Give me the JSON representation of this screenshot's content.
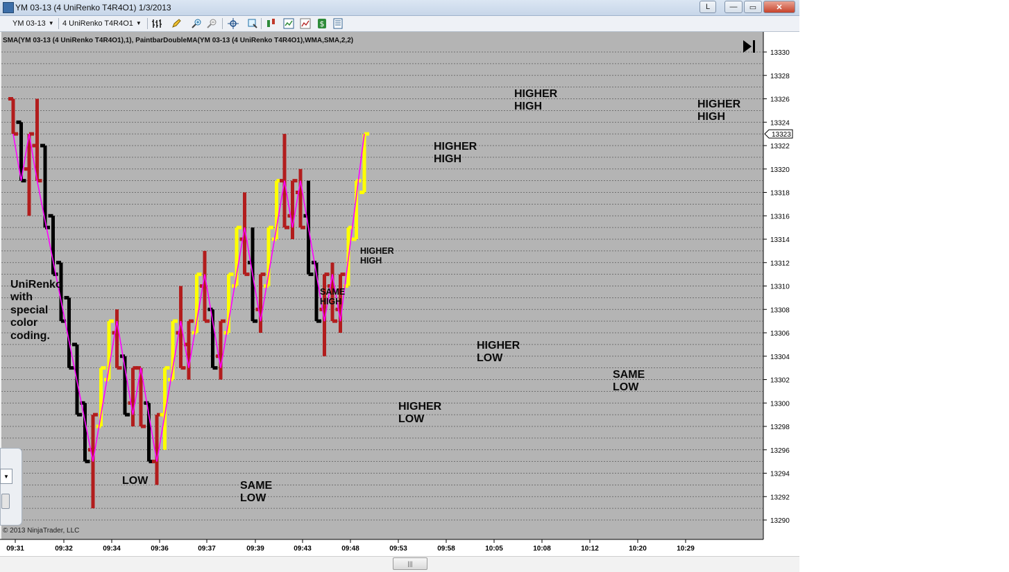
{
  "window": {
    "title": "YM 03-13 (4 UniRenko T4R4O1)  1/3/2013",
    "controls": {
      "l_label": "L",
      "minimize": "—",
      "maximize": "▭",
      "close": "✕"
    }
  },
  "toolbar": {
    "instrument": "YM 03-13",
    "period": "4 UniRenko T4R4O1",
    "icons": [
      "bar-type-icon",
      "pencil-icon",
      "zoom-in-icon",
      "zoom-out-icon",
      "crosshair-icon",
      "magnifier-icon",
      "strategy-icon",
      "indicator-icon",
      "chart-trader-icon",
      "money-icon",
      "properties-icon"
    ]
  },
  "chart": {
    "indicator_label": "SMA(YM 03-13 (4 UniRenko T4R4O1),1), PaintbarDoubleMA(YM 03-13 (4 UniRenko T4R4O1),WMA,SMA,2,2)",
    "copyright": "© 2013 NinjaTrader, LLC",
    "current_price": "13323",
    "colors": {
      "background": "#b4b4b4",
      "red": "#b21d1d",
      "black": "#000000",
      "yellow": "#ffff00",
      "line": "#ff00ff"
    }
  },
  "chart_data": {
    "type": "bar",
    "y_ticks": [
      13290,
      13292,
      13294,
      13296,
      13298,
      13300,
      13302,
      13304,
      13306,
      13308,
      13310,
      13312,
      13314,
      13316,
      13318,
      13320,
      13322,
      13324,
      13326,
      13328,
      13330
    ],
    "ylim": [
      13289,
      13331
    ],
    "x_ticks": [
      "09:31",
      "09:32",
      "09:34",
      "09:36",
      "09:37",
      "09:39",
      "09:43",
      "09:48",
      "09:53",
      "09:58",
      "10:05",
      "10:08",
      "10:12",
      "10:20",
      "10:29"
    ],
    "bars": [
      {
        "c": "r",
        "h": 13326,
        "l": 13323,
        "o": 13326,
        "cl": 13323
      },
      {
        "c": "k",
        "h": 13324,
        "l": 13319,
        "o": 13324,
        "cl": 13319
      },
      {
        "c": "r",
        "h": 13323,
        "l": 13316,
        "o": 13320,
        "cl": 13323
      },
      {
        "c": "r",
        "h": 13326,
        "l": 13319,
        "o": 13322,
        "cl": 13319
      },
      {
        "c": "k",
        "h": 13322,
        "l": 13315,
        "o": 13322,
        "cl": 13315
      },
      {
        "c": "k",
        "h": 13316,
        "l": 13311,
        "o": 13316,
        "cl": 13311
      },
      {
        "c": "k",
        "h": 13312,
        "l": 13307,
        "o": 13312,
        "cl": 13307
      },
      {
        "c": "k",
        "h": 13309,
        "l": 13303,
        "o": 13309,
        "cl": 13303
      },
      {
        "c": "k",
        "h": 13305,
        "l": 13299,
        "o": 13305,
        "cl": 13299
      },
      {
        "c": "k",
        "h": 13300,
        "l": 13295,
        "o": 13300,
        "cl": 13295
      },
      {
        "c": "r",
        "h": 13299,
        "l": 13291,
        "o": 13296,
        "cl": 13299
      },
      {
        "c": "y",
        "h": 13303,
        "l": 13298,
        "o": 13298,
        "cl": 13303
      },
      {
        "c": "y",
        "h": 13307,
        "l": 13302,
        "o": 13302,
        "cl": 13307
      },
      {
        "c": "r",
        "h": 13308,
        "l": 13303,
        "o": 13306,
        "cl": 13303
      },
      {
        "c": "k",
        "h": 13304,
        "l": 13299,
        "o": 13304,
        "cl": 13299
      },
      {
        "c": "r",
        "h": 13303,
        "l": 13298,
        "o": 13300,
        "cl": 13303
      },
      {
        "c": "r",
        "h": 13303,
        "l": 13298,
        "o": 13303,
        "cl": 13298
      },
      {
        "c": "k",
        "h": 13300,
        "l": 13295,
        "o": 13300,
        "cl": 13295
      },
      {
        "c": "r",
        "h": 13299,
        "l": 13293,
        "o": 13295,
        "cl": 13299
      },
      {
        "c": "y",
        "h": 13303,
        "l": 13296,
        "o": 13299,
        "cl": 13303
      },
      {
        "c": "y",
        "h": 13307,
        "l": 13302,
        "o": 13302,
        "cl": 13307
      },
      {
        "c": "r",
        "h": 13310,
        "l": 13303,
        "o": 13306,
        "cl": 13303
      },
      {
        "c": "r",
        "h": 13307,
        "l": 13302,
        "o": 13305,
        "cl": 13307
      },
      {
        "c": "y",
        "h": 13311,
        "l": 13306,
        "o": 13306,
        "cl": 13311
      },
      {
        "c": "r",
        "h": 13313,
        "l": 13307,
        "o": 13310,
        "cl": 13307
      },
      {
        "c": "k",
        "h": 13308,
        "l": 13303,
        "o": 13308,
        "cl": 13303
      },
      {
        "c": "r",
        "h": 13307,
        "l": 13302,
        "o": 13304,
        "cl": 13307
      },
      {
        "c": "y",
        "h": 13311,
        "l": 13306,
        "o": 13306,
        "cl": 13311
      },
      {
        "c": "y",
        "h": 13315,
        "l": 13310,
        "o": 13310,
        "cl": 13315
      },
      {
        "c": "r",
        "h": 13318,
        "l": 13311,
        "o": 13314,
        "cl": 13311
      },
      {
        "c": "k",
        "h": 13315,
        "l": 13307,
        "o": 13312,
        "cl": 13307
      },
      {
        "c": "r",
        "h": 13311,
        "l": 13306,
        "o": 13308,
        "cl": 13311
      },
      {
        "c": "y",
        "h": 13315,
        "l": 13310,
        "o": 13310,
        "cl": 13315
      },
      {
        "c": "y",
        "h": 13319,
        "l": 13314,
        "o": 13314,
        "cl": 13319
      },
      {
        "c": "r",
        "h": 13323,
        "l": 13315,
        "o": 13319,
        "cl": 13315
      },
      {
        "c": "r",
        "h": 13319,
        "l": 13314,
        "o": 13316,
        "cl": 13319
      },
      {
        "c": "r",
        "h": 13320,
        "l": 13315,
        "o": 13318,
        "cl": 13315
      },
      {
        "c": "k",
        "h": 13319,
        "l": 13311,
        "o": 13316,
        "cl": 13311
      },
      {
        "c": "k",
        "h": 13312,
        "l": 13307,
        "o": 13312,
        "cl": 13307
      },
      {
        "c": "r",
        "h": 13311,
        "l": 13304,
        "o": 13308,
        "cl": 13311
      },
      {
        "c": "r",
        "h": 13312,
        "l": 13307,
        "o": 13310,
        "cl": 13307
      },
      {
        "c": "r",
        "h": 13311,
        "l": 13306,
        "o": 13308,
        "cl": 13311
      },
      {
        "c": "y",
        "h": 13315,
        "l": 13310,
        "o": 13310,
        "cl": 13315
      },
      {
        "c": "y",
        "h": 13319,
        "l": 13314,
        "o": 13314,
        "cl": 13319
      },
      {
        "c": "y",
        "h": 13323,
        "l": 13318,
        "o": 13318,
        "cl": 13323
      }
    ],
    "zigzag": [
      {
        "i": 0,
        "v": 13323
      },
      {
        "i": 1,
        "v": 13319
      },
      {
        "i": 2,
        "v": 13323
      },
      {
        "i": 3,
        "v": 13319
      },
      {
        "i": 10,
        "v": 13295
      },
      {
        "i": 13,
        "v": 13307
      },
      {
        "i": 15,
        "v": 13299
      },
      {
        "i": 16,
        "v": 13303
      },
      {
        "i": 18,
        "v": 13295
      },
      {
        "i": 21,
        "v": 13307
      },
      {
        "i": 22,
        "v": 13303
      },
      {
        "i": 24,
        "v": 13311
      },
      {
        "i": 26,
        "v": 13303
      },
      {
        "i": 29,
        "v": 13315
      },
      {
        "i": 31,
        "v": 13307
      },
      {
        "i": 34,
        "v": 13319
      },
      {
        "i": 35,
        "v": 13315
      },
      {
        "i": 36,
        "v": 13319
      },
      {
        "i": 38,
        "v": 13311
      },
      {
        "i": 39,
        "v": 13307
      },
      {
        "i": 40,
        "v": 13311
      },
      {
        "i": 41,
        "v": 13307
      },
      {
        "i": 44,
        "v": 13323
      }
    ]
  },
  "annotations": [
    {
      "text": "UniRenko\nwith\nspecial\ncolor\ncoding.",
      "size": "big"
    },
    {
      "text": "LOW",
      "size": "big"
    },
    {
      "text": "SAME\nLOW",
      "size": "big"
    },
    {
      "text": "SAME\nHIGH",
      "size": "small"
    },
    {
      "text": "HIGHER\nHIGH",
      "size": "small"
    },
    {
      "text": "HIGHER\nLOW",
      "size": "big"
    },
    {
      "text": "HIGHER\nHIGH",
      "size": "big"
    },
    {
      "text": "HIGHER\nLOW",
      "size": "big"
    },
    {
      "text": "HIGHER\nHIGH",
      "size": "big"
    },
    {
      "text": "SAME\nLOW",
      "size": "big"
    },
    {
      "text": "HIGHER\nHIGH",
      "size": "big"
    }
  ]
}
